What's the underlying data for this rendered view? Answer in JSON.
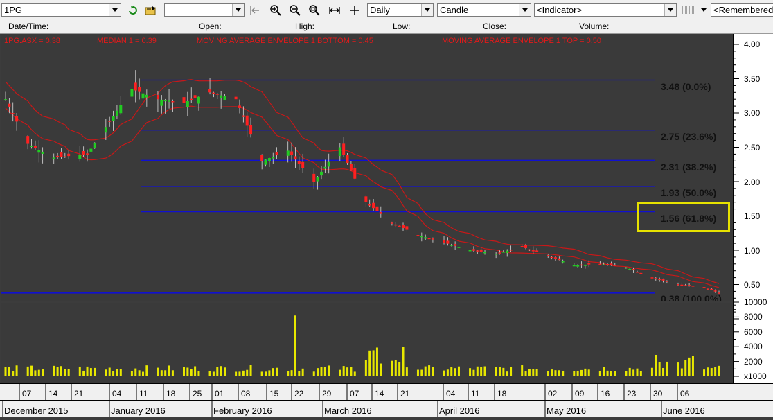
{
  "toolbar": {
    "symbol": "1PG",
    "blank_combo": "",
    "period": "Daily",
    "chart_style": "Candle",
    "indicator": "<Indicator>",
    "remembered": "<Remembered"
  },
  "info_headers": {
    "date_time": "Date/Time:",
    "open": "Open:",
    "high": "High:",
    "low": "Low:",
    "close": "Close:",
    "volume": "Volume:"
  },
  "legend": {
    "price": "1PG.ASX = 0.38",
    "median": "MEDIAN 1 = 0.39",
    "env_bottom": "MOVING AVERAGE ENVELOPE 1 BOTTOM = 0.45",
    "env_top": "MOVING AVERAGE ENVELOPE 1 TOP = 0.50"
  },
  "fib_labels": [
    "3.48 (0.0%)",
    "2.75 (23.6%)",
    "2.31 (38.2%)",
    "1.93 (50.0%)",
    "1.56 (61.8%)",
    "0.38 (100.0%)"
  ],
  "y_ticks_price": [
    "4.00",
    "3.50",
    "3.00",
    "2.50",
    "2.00",
    "1.50",
    "1.00",
    "0.50"
  ],
  "y_ticks_volume": [
    "10000",
    "8000",
    "6000",
    "4000",
    "2000",
    "x1000"
  ],
  "x_days": [
    "07",
    "14",
    "21",
    "04",
    "11",
    "18",
    "25",
    "01",
    "08",
    "15",
    "22",
    "29",
    "07",
    "14",
    "21",
    "04",
    "11",
    "18",
    "02",
    "09",
    "16",
    "23",
    "30",
    "06"
  ],
  "x_months": [
    "December 2015",
    "January 2016",
    "February 2016",
    "March 2016",
    "April 2016",
    "May 2016",
    "June 2016"
  ],
  "colors": {
    "bull": "#22cc22",
    "bear": "#ff2020",
    "envelope": "#c81818",
    "fib_line": "#1010d0",
    "volume": "#e8e800",
    "highlight": "#e6e200"
  },
  "chart_data": {
    "type": "candlestick",
    "price_ylim": [
      0.0,
      4.0
    ],
    "volume_ylim": [
      0,
      10000
    ],
    "volume_unit": "x1000",
    "fibonacci_retracement": [
      {
        "price": 3.48,
        "pct": 0.0
      },
      {
        "price": 2.75,
        "pct": 23.6
      },
      {
        "price": 2.31,
        "pct": 38.2
      },
      {
        "price": 1.93,
        "pct": 50.0
      },
      {
        "price": 1.56,
        "pct": 61.8
      },
      {
        "price": 0.38,
        "pct": 100.0
      }
    ],
    "close_path_approx": [
      {
        "date": "2015-12-01",
        "close": 3.2
      },
      {
        "date": "2015-12-07",
        "close": 2.55
      },
      {
        "date": "2015-12-14",
        "close": 2.35
      },
      {
        "date": "2015-12-23",
        "close": 2.4
      },
      {
        "date": "2016-01-04",
        "close": 3.35
      },
      {
        "date": "2016-01-11",
        "close": 3.2
      },
      {
        "date": "2016-01-18",
        "close": 3.15
      },
      {
        "date": "2016-01-25",
        "close": 3.3
      },
      {
        "date": "2016-02-01",
        "close": 3.2
      },
      {
        "date": "2016-02-08",
        "close": 2.3
      },
      {
        "date": "2016-02-15",
        "close": 2.45
      },
      {
        "date": "2016-02-22",
        "close": 2.0
      },
      {
        "date": "2016-02-29",
        "close": 2.5
      },
      {
        "date": "2016-03-07",
        "close": 1.7
      },
      {
        "date": "2016-03-14",
        "close": 1.4
      },
      {
        "date": "2016-03-21",
        "close": 1.22
      },
      {
        "date": "2016-04-04",
        "close": 1.0
      },
      {
        "date": "2016-04-11",
        "close": 0.95
      },
      {
        "date": "2016-04-18",
        "close": 1.05
      },
      {
        "date": "2016-05-02",
        "close": 0.78
      },
      {
        "date": "2016-05-09",
        "close": 0.8
      },
      {
        "date": "2016-05-16",
        "close": 0.75
      },
      {
        "date": "2016-05-23",
        "close": 0.6
      },
      {
        "date": "2016-05-30",
        "close": 0.5
      },
      {
        "date": "2016-06-06",
        "close": 0.45
      },
      {
        "date": "2016-06-10",
        "close": 0.38
      }
    ],
    "volume_spike": {
      "date": "2016-02-17",
      "volume": 8200
    }
  }
}
